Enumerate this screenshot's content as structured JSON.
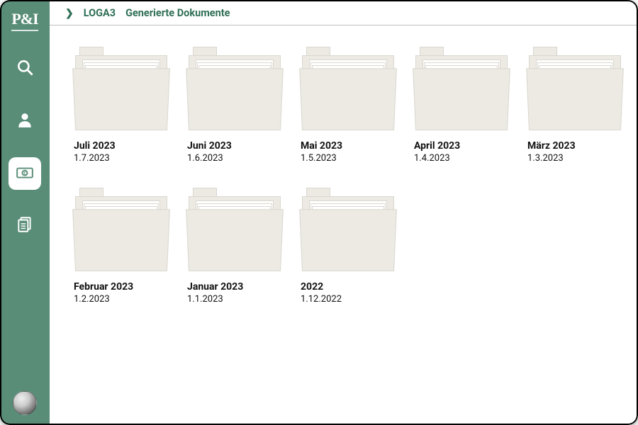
{
  "logo": "P&I",
  "breadcrumb": {
    "seg1": "LOGA3",
    "seg2": "Generierte Dokumente"
  },
  "sidebar": {
    "items": [
      {
        "id": "search",
        "active": false
      },
      {
        "id": "profile",
        "active": false
      },
      {
        "id": "payroll",
        "active": true
      },
      {
        "id": "docs",
        "active": false
      }
    ]
  },
  "folders": [
    {
      "name": "Juli 2023",
      "date": "1.7.2023"
    },
    {
      "name": "Juni 2023",
      "date": "1.6.2023"
    },
    {
      "name": "Mai 2023",
      "date": "1.5.2023"
    },
    {
      "name": "April 2023",
      "date": "1.4.2023"
    },
    {
      "name": "März 2023",
      "date": "1.3.2023"
    },
    {
      "name": "Februar 2023",
      "date": "1.2.2023"
    },
    {
      "name": "Januar 2023",
      "date": "1.1.2023"
    },
    {
      "name": "2022",
      "date": "1.12.2022"
    }
  ]
}
